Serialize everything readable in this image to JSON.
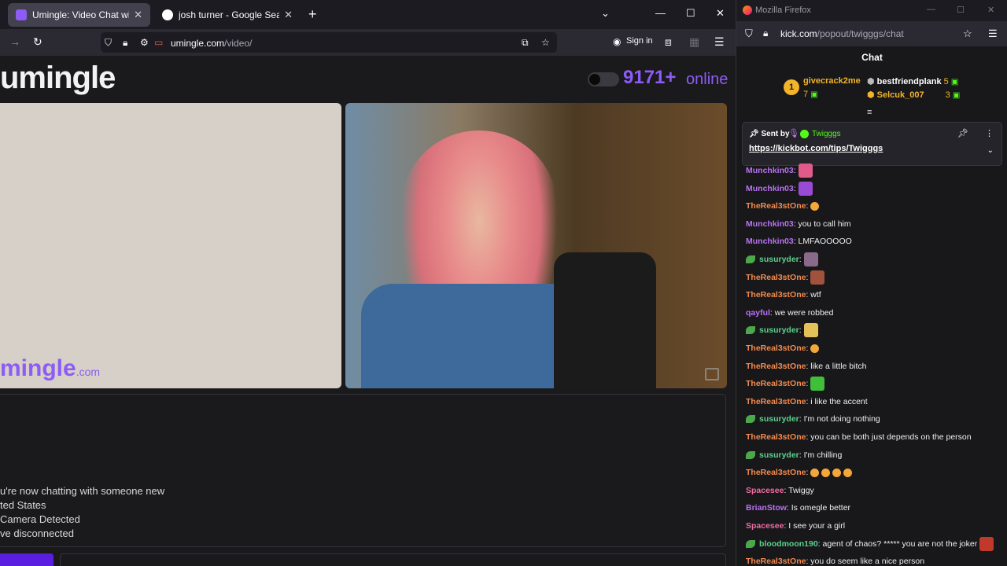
{
  "left_window": {
    "tabs": [
      {
        "label": "Umingle: Video Chat with Stran",
        "active": true,
        "favicon_color": "#8c5cf5"
      },
      {
        "label": "josh turner - Google Search",
        "active": false,
        "favicon_color": "#ffffff"
      }
    ],
    "url": {
      "host": "umingle.com",
      "path": "/video/"
    },
    "sign_in_label": "Sign in",
    "page": {
      "logo": "umingle",
      "online_count": "9171+",
      "online_label": "online",
      "watermark": "mingle",
      "watermark_suffix": ".com",
      "system_messages": [
        "u're now chatting with someone new",
        "ted States",
        "Camera Detected",
        "ve disconnected"
      ]
    }
  },
  "right_window": {
    "title": "Mozilla Firefox",
    "url": {
      "host": "kick.com",
      "path": "/popout/twigggs/chat"
    },
    "chat_title": "Chat",
    "leaderboard": [
      {
        "rank": "1",
        "name": "givecrack2me",
        "count": "7",
        "color": "#f3b32a"
      },
      {
        "name": "bestfriendplank",
        "count": "5",
        "color": "#ffffff"
      },
      {
        "name": "Selcuk_007",
        "count": "3",
        "color": "#f3b32a"
      }
    ],
    "pinned": {
      "sent_by_label": "Sent by",
      "sender": "Twigggs",
      "link": "https://kickbot.com/tips/Twigggs"
    },
    "messages": [
      {
        "user": "Munchkin03",
        "color": "#b972f2",
        "text": ":",
        "emote": "#e05a8c"
      },
      {
        "user": "Munchkin03",
        "color": "#b972f2",
        "text": ":",
        "emote": "#9a4bd6"
      },
      {
        "user": "TheReal3stOne",
        "color": "#f58a4c",
        "text": ":",
        "emoji": true
      },
      {
        "user": "Munchkin03",
        "color": "#b972f2",
        "text": ": you to call him"
      },
      {
        "user": "Munchkin03",
        "color": "#b972f2",
        "text": ": LMFAOOOOO"
      },
      {
        "user": "susuryder",
        "color": "#5cd28c",
        "text": ":",
        "leaf": true,
        "emote": "#8a6a8a"
      },
      {
        "user": "TheReal3stOne",
        "color": "#f58a4c",
        "text": ":",
        "emote": "#a0523c"
      },
      {
        "user": "TheReal3stOne",
        "color": "#f58a4c",
        "text": ": wtf"
      },
      {
        "user": "qayful",
        "color": "#b972f2",
        "text": ": we were robbed"
      },
      {
        "user": "susuryder",
        "color": "#5cd28c",
        "text": ":",
        "leaf": true,
        "emote": "#e4c25a"
      },
      {
        "user": "TheReal3stOne",
        "color": "#f58a4c",
        "text": ":",
        "emoji": true
      },
      {
        "user": "TheReal3stOne",
        "color": "#f58a4c",
        "text": ": like a little bitch"
      },
      {
        "user": "TheReal3stOne",
        "color": "#f58a4c",
        "text": ":",
        "emote": "#3fbf3a"
      },
      {
        "user": "TheReal3stOne",
        "color": "#f58a4c",
        "text": ": i like the accent"
      },
      {
        "user": "susuryder",
        "color": "#5cd28c",
        "text": ": I'm not doing nothing",
        "leaf": true
      },
      {
        "user": "TheReal3stOne",
        "color": "#f58a4c",
        "text": ": you can be both just depends on the person"
      },
      {
        "user": "susuryder",
        "color": "#5cd28c",
        "text": ": I'm chilling",
        "leaf": true
      },
      {
        "user": "TheReal3stOne",
        "color": "#f58a4c",
        "text": ":",
        "emoji_count": 4
      },
      {
        "user": "Spacesee",
        "color": "#f06ca0",
        "text": ": Twiggy"
      },
      {
        "user": "BrianStow",
        "color": "#b972f2",
        "text": ": Is omegle better"
      },
      {
        "user": "Spacesee",
        "color": "#f06ca0",
        "text": ": I see your a girl"
      },
      {
        "user": "bloodmoon190",
        "color": "#5cd28c",
        "text": ": agent of chaos? ***** you are not the joker",
        "leaf": true,
        "emote": "#c0392b"
      },
      {
        "user": "TheReal3stOne",
        "color": "#f58a4c",
        "text": ": you do seem like a nice person"
      }
    ]
  }
}
